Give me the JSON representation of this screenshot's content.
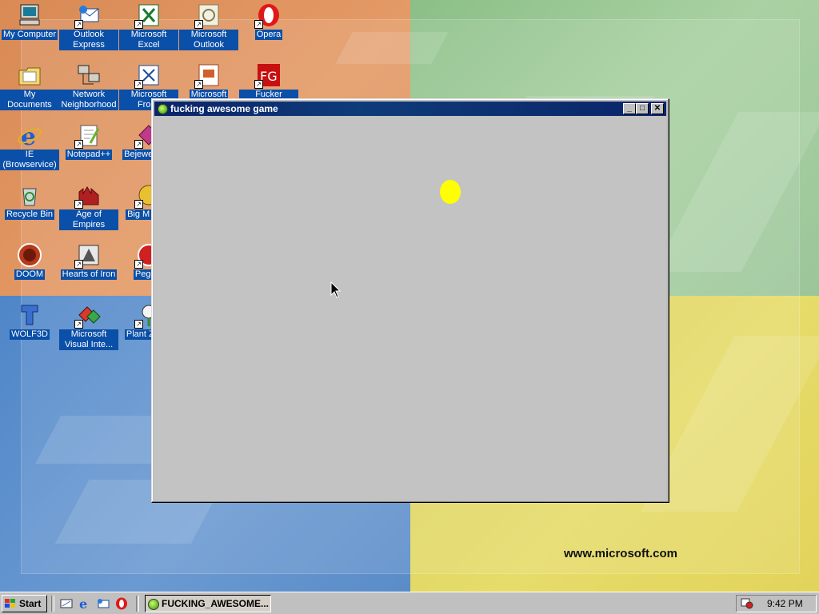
{
  "desktop": {
    "brand_text": "www.microsoft.com",
    "colors": {
      "orange": "#e0935f",
      "green": "#9ec89a",
      "blue": "#5a8cc8",
      "yellow": "#e2d760",
      "label_bg": "#0a4fa8"
    },
    "icons": [
      {
        "label": "My Computer",
        "icon": "computer-icon",
        "shortcut": false
      },
      {
        "label": "Outlook Express",
        "icon": "outlook-express-icon",
        "shortcut": true
      },
      {
        "label": "Microsoft Excel",
        "icon": "excel-icon",
        "shortcut": true
      },
      {
        "label": "Microsoft Outlook",
        "icon": "outlook-icon",
        "shortcut": true
      },
      {
        "label": "Opera",
        "icon": "opera-icon",
        "shortcut": true
      },
      {
        "label": "My Documents",
        "icon": "folder-icon",
        "shortcut": false
      },
      {
        "label": "Network Neighborhood",
        "icon": "network-icon",
        "shortcut": false
      },
      {
        "label": "Microsoft Frontl",
        "icon": "frontpage-icon",
        "shortcut": true
      },
      {
        "label": "Microsoft",
        "icon": "powerpoint-icon",
        "shortcut": true
      },
      {
        "label": "Fucker Google",
        "icon": "fg-icon",
        "shortcut": true
      },
      {
        "label": "IE (Browservice)",
        "icon": "internet-explorer-icon",
        "shortcut": false
      },
      {
        "label": "Notepad++",
        "icon": "notepad-icon",
        "shortcut": true
      },
      {
        "label": "Bejewe Delu",
        "icon": "bejeweled-icon",
        "shortcut": true
      },
      {
        "label": "Recycle Bin",
        "icon": "recycle-bin-icon",
        "shortcut": false
      },
      {
        "label": "Age of Empires",
        "icon": "age-of-empires-icon",
        "shortcut": true
      },
      {
        "label": "Big M Delu",
        "icon": "big-money-icon",
        "shortcut": true
      },
      {
        "label": "DOOM",
        "icon": "doom-icon",
        "shortcut": false
      },
      {
        "label": "Hearts of Iron",
        "icon": "hearts-of-iron-icon",
        "shortcut": true
      },
      {
        "label": "Peggle",
        "icon": "peggle-icon",
        "shortcut": true
      },
      {
        "label": "WOLF3D",
        "icon": "wolf3d-icon",
        "shortcut": false
      },
      {
        "label": "Microsoft Visual Inte...",
        "icon": "visual-interdev-icon",
        "shortcut": true
      },
      {
        "label": "Plant Zomb",
        "icon": "plants-zombies-icon",
        "shortcut": true
      }
    ]
  },
  "window": {
    "title": "fucking awesome game",
    "minimize": "_",
    "maximize": "□",
    "close": "✕",
    "client_bg": "#c3c3c3",
    "ball_color": "#ffff00"
  },
  "taskbar": {
    "start_label": "Start",
    "task_label": "FUCKING_AWESOME...",
    "clock": "9:42 PM",
    "quick_launch": [
      "show-desktop-icon",
      "internet-explorer-icon",
      "outlook-express-icon",
      "opera-icon"
    ]
  }
}
